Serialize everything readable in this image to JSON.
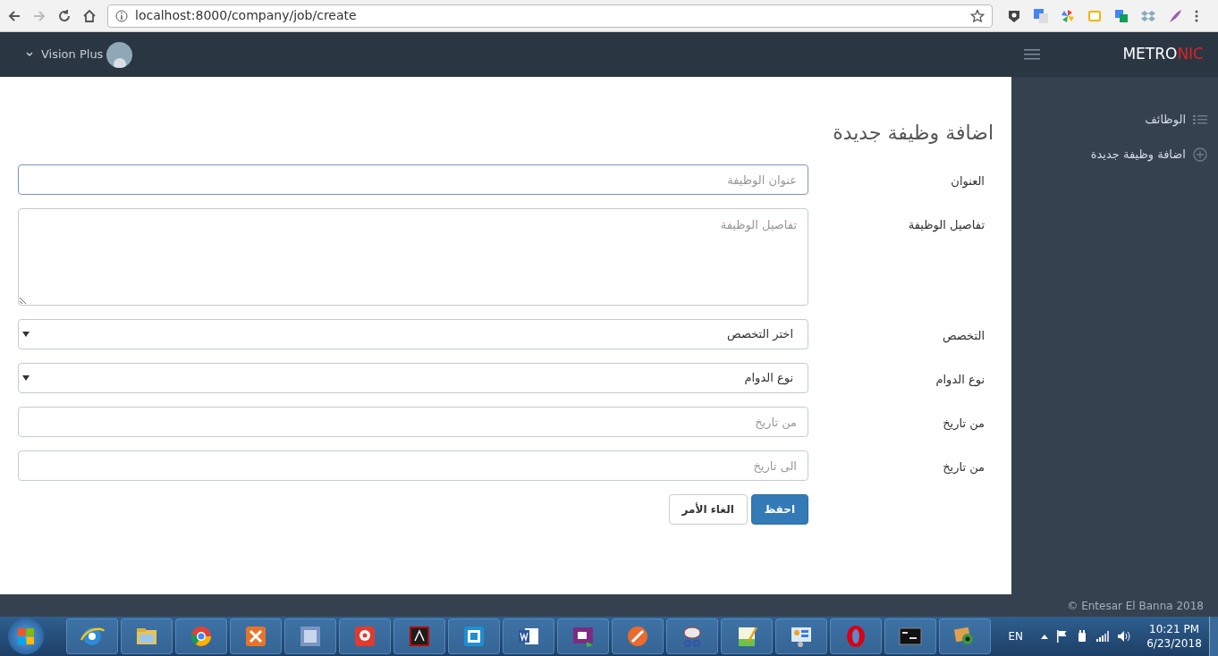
{
  "browser": {
    "url": "localhost:8000/company/job/create"
  },
  "header": {
    "user_name": "Vision Plus",
    "logo_main": "METRO",
    "logo_accent": "NIC"
  },
  "sidebar": {
    "items": [
      {
        "label": "الوظائف",
        "kind": "list",
        "selected": false
      },
      {
        "label": "اضافة وظيفة جديدة",
        "kind": "add",
        "selected": false
      }
    ]
  },
  "page_title": "اضافة وظيفة جديدة",
  "form": {
    "fields": [
      {
        "label": "العنوان",
        "kind": "input",
        "placeholder": "عنوان الوظيفة",
        "focused": true
      },
      {
        "label": "تفاصيل الوظيفة",
        "kind": "textarea",
        "placeholder": "تفاصيل الوظيفة",
        "focused": false
      },
      {
        "label": "التخصص",
        "kind": "select",
        "value": "اختر التخصص",
        "focused": false
      },
      {
        "label": "نوع الدوام",
        "kind": "select",
        "value": "نوع الدوام",
        "focused": false
      },
      {
        "label": "من تاريخ",
        "kind": "input",
        "placeholder": "من تاريخ",
        "focused": false
      },
      {
        "label": "من تاريخ",
        "kind": "input",
        "placeholder": "الى تاريخ",
        "focused": false
      }
    ],
    "buttons": [
      {
        "label": "احفظ",
        "kind": "primary"
      },
      {
        "label": "الغاء الأمر",
        "kind": "default"
      }
    ]
  },
  "footer": "© Entesar El Banna 2018",
  "taskbar": {
    "language": "EN",
    "time": "10:21 PM",
    "date": "6/23/2018"
  }
}
